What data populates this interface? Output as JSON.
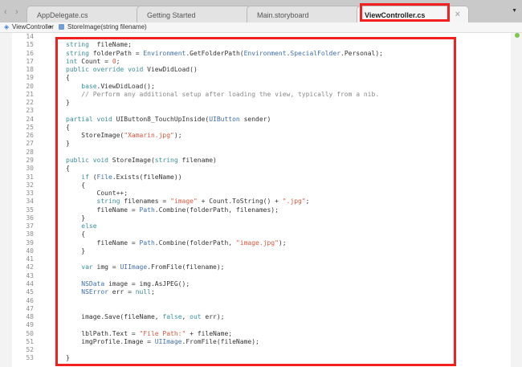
{
  "tabs": [
    {
      "label": "AppDelegate.cs",
      "active": false
    },
    {
      "label": "Getting Started",
      "active": false
    },
    {
      "label": "Main.storyboard",
      "active": false
    },
    {
      "label": "ViewController.cs",
      "active": true
    }
  ],
  "nav": {
    "back": "‹",
    "forward": "›",
    "more": "▼",
    "close": "×"
  },
  "breadcrumb": {
    "class": "ViewController",
    "separator": "▸",
    "method": "StoreImage(string filename)"
  },
  "colors": {
    "highlight": "#f2201e",
    "keyword": "#3b8f9c",
    "type": "#3f6fb0",
    "string": "#d9573d",
    "comment": "#8a8a8a",
    "status_dot": "#7fc64a"
  },
  "code_lines": [
    {
      "n": "14",
      "t": []
    },
    {
      "n": "15",
      "t": [
        [
          "kw",
          "string"
        ],
        [
          "",
          "  fileName;"
        ]
      ]
    },
    {
      "n": "16",
      "t": [
        [
          "kw",
          "string"
        ],
        [
          "",
          " folderPath = "
        ],
        [
          "ty",
          "Environment"
        ],
        [
          "",
          ".GetFolderPath("
        ],
        [
          "ty",
          "Environment"
        ],
        [
          "",
          "."
        ],
        [
          "ty",
          "SpecialFolder"
        ],
        [
          "",
          ".Personal);"
        ]
      ]
    },
    {
      "n": "17",
      "t": [
        [
          "kw",
          "int"
        ],
        [
          "",
          " Count = "
        ],
        [
          "num",
          "0"
        ],
        [
          "",
          ";"
        ]
      ]
    },
    {
      "n": "18",
      "t": [
        [
          "kw",
          "public override void"
        ],
        [
          "",
          " ViewDidLoad()"
        ]
      ]
    },
    {
      "n": "19",
      "t": [
        [
          "",
          "{"
        ]
      ]
    },
    {
      "n": "20",
      "t": [
        [
          "",
          "    "
        ],
        [
          "kw",
          "base"
        ],
        [
          "",
          ".ViewDidLoad();"
        ]
      ]
    },
    {
      "n": "21",
      "t": [
        [
          "cm",
          "    // Perform any additional setup after loading the view, typically from a nib."
        ]
      ]
    },
    {
      "n": "22",
      "t": [
        [
          "",
          "}"
        ]
      ]
    },
    {
      "n": "23",
      "t": []
    },
    {
      "n": "24",
      "t": [
        [
          "kw",
          "partial void"
        ],
        [
          "",
          " UIButton8_TouchUpInside("
        ],
        [
          "ty",
          "UIButton"
        ],
        [
          "",
          " sender)"
        ]
      ]
    },
    {
      "n": "25",
      "t": [
        [
          "",
          "{"
        ]
      ]
    },
    {
      "n": "26",
      "t": [
        [
          "",
          "    StoreImage("
        ],
        [
          "str",
          "\"Xamarin.jpg\""
        ],
        [
          "",
          ");"
        ]
      ]
    },
    {
      "n": "27",
      "t": [
        [
          "",
          "}"
        ]
      ]
    },
    {
      "n": "28",
      "t": []
    },
    {
      "n": "29",
      "t": [
        [
          "kw",
          "public void"
        ],
        [
          "",
          " StoreImage("
        ],
        [
          "kw",
          "string"
        ],
        [
          "",
          " filename)"
        ]
      ]
    },
    {
      "n": "30",
      "t": [
        [
          "",
          "{"
        ]
      ]
    },
    {
      "n": "31",
      "t": [
        [
          "",
          "    "
        ],
        [
          "kw",
          "if"
        ],
        [
          "",
          " ("
        ],
        [
          "ty",
          "File"
        ],
        [
          "",
          ".Exists(fileName))"
        ]
      ]
    },
    {
      "n": "32",
      "t": [
        [
          "",
          "    {"
        ]
      ]
    },
    {
      "n": "33",
      "t": [
        [
          "",
          "        Count++;"
        ]
      ]
    },
    {
      "n": "34",
      "t": [
        [
          "",
          "        "
        ],
        [
          "kw",
          "string"
        ],
        [
          "",
          " filenames = "
        ],
        [
          "str",
          "\"image\""
        ],
        [
          "",
          " + Count.ToString() + "
        ],
        [
          "str",
          "\".jpg\""
        ],
        [
          "",
          ";"
        ]
      ]
    },
    {
      "n": "35",
      "t": [
        [
          "",
          "        fileName = "
        ],
        [
          "ty",
          "Path"
        ],
        [
          "",
          ".Combine(folderPath, filenames);"
        ]
      ]
    },
    {
      "n": "36",
      "t": [
        [
          "",
          "    }"
        ]
      ]
    },
    {
      "n": "37",
      "t": [
        [
          "",
          "    "
        ],
        [
          "kw",
          "else"
        ]
      ]
    },
    {
      "n": "38",
      "t": [
        [
          "",
          "    {"
        ]
      ]
    },
    {
      "n": "39",
      "t": [
        [
          "",
          "        fileName = "
        ],
        [
          "ty",
          "Path"
        ],
        [
          "",
          ".Combine(folderPath, "
        ],
        [
          "str",
          "\"image.jpg\""
        ],
        [
          "",
          ");"
        ]
      ]
    },
    {
      "n": "40",
      "t": [
        [
          "",
          "    }"
        ]
      ]
    },
    {
      "n": "41",
      "t": []
    },
    {
      "n": "42",
      "t": [
        [
          "",
          "    "
        ],
        [
          "kw",
          "var"
        ],
        [
          "",
          " img = "
        ],
        [
          "ty",
          "UIImage"
        ],
        [
          "",
          ".FromFile(filename);"
        ]
      ]
    },
    {
      "n": "43",
      "t": []
    },
    {
      "n": "44",
      "t": [
        [
          "",
          "    "
        ],
        [
          "ty",
          "NSData"
        ],
        [
          "",
          " image = img.AsJPEG();"
        ]
      ]
    },
    {
      "n": "45",
      "t": [
        [
          "",
          "    "
        ],
        [
          "ty",
          "NSError"
        ],
        [
          "",
          " err = "
        ],
        [
          "kw",
          "null"
        ],
        [
          "",
          ";"
        ]
      ]
    },
    {
      "n": "46",
      "t": []
    },
    {
      "n": "47",
      "t": []
    },
    {
      "n": "48",
      "t": [
        [
          "",
          "    image.Save(fileName, "
        ],
        [
          "kw",
          "false"
        ],
        [
          "",
          ", "
        ],
        [
          "kw",
          "out"
        ],
        [
          "",
          " err);"
        ]
      ]
    },
    {
      "n": "49",
      "t": []
    },
    {
      "n": "50",
      "t": [
        [
          "",
          "    lblPath.Text = "
        ],
        [
          "str",
          "\"File Path:\""
        ],
        [
          "",
          " + fileName;"
        ]
      ]
    },
    {
      "n": "51",
      "t": [
        [
          "",
          "    imgProfile.Image = "
        ],
        [
          "ty",
          "UIImage"
        ],
        [
          "",
          ".FromFile(fileName);"
        ]
      ]
    },
    {
      "n": "52",
      "t": []
    },
    {
      "n": "53",
      "t": [
        [
          "",
          "}"
        ]
      ]
    }
  ]
}
